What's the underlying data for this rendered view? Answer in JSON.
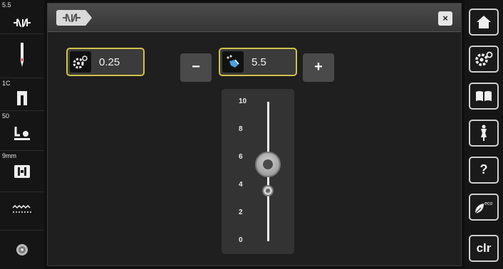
{
  "left_sidebar": {
    "stitch_width": "5.5",
    "needle_number": "",
    "foot_number": "1C",
    "pressure_number": "50",
    "plate_label": "9mm",
    "icons": [
      "stitch-pattern-icon",
      "needle-icon",
      "presser-foot-icon",
      "presser-foot-pressure-icon",
      "stitch-plate-icon",
      "feed-dog-icon",
      "thread-tension-icon"
    ]
  },
  "main": {
    "step_minus": "−",
    "step_plus": "+",
    "setting_left": {
      "icon": "gear-adjust-icon",
      "value": "0.25"
    },
    "setting_center": {
      "icon": "stitch-width-hand-icon",
      "value": "5.5"
    },
    "slider": {
      "ticks": [
        "10",
        "8",
        "6",
        "4",
        "2",
        "0"
      ],
      "min": 0,
      "max": 10,
      "current": 5.5,
      "default": 3.5
    }
  },
  "right_bar": {
    "buttons": [
      "home-icon",
      "settings-icon",
      "tutorial-book-icon",
      "sewing-guide-icon",
      "help-icon",
      "eco-icon",
      "clr"
    ],
    "help_label": "?",
    "clr_label": "clr"
  },
  "colors": {
    "highlight": "#cfc24a",
    "panel": "#1f1f1f",
    "button": "#4a4a4a"
  }
}
